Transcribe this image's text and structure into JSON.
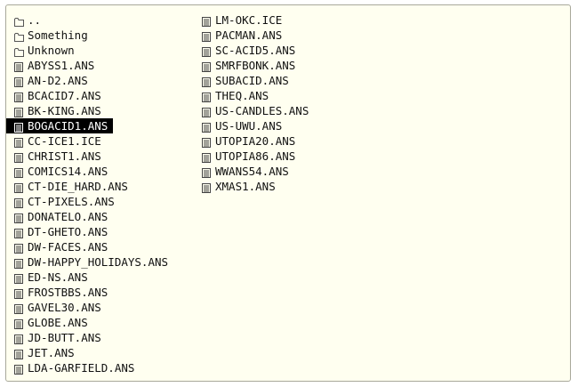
{
  "selected": "BOGACID1.ANS",
  "columns": [
    [
      {
        "name": "..",
        "type": "folder"
      },
      {
        "name": "Something",
        "type": "folder"
      },
      {
        "name": "Unknown",
        "type": "folder"
      },
      {
        "name": "ABYSS1.ANS",
        "type": "file"
      },
      {
        "name": "AN-D2.ANS",
        "type": "file"
      },
      {
        "name": "BCACID7.ANS",
        "type": "file"
      },
      {
        "name": "BK-KING.ANS",
        "type": "file"
      },
      {
        "name": "BOGACID1.ANS",
        "type": "file"
      },
      {
        "name": "CC-ICE1.ICE",
        "type": "file"
      },
      {
        "name": "CHRIST1.ANS",
        "type": "file"
      },
      {
        "name": "COMICS14.ANS",
        "type": "file"
      },
      {
        "name": "CT-DIE_HARD.ANS",
        "type": "file"
      },
      {
        "name": "CT-PIXELS.ANS",
        "type": "file"
      },
      {
        "name": "DONATELO.ANS",
        "type": "file"
      },
      {
        "name": "DT-GHETO.ANS",
        "type": "file"
      },
      {
        "name": "DW-FACES.ANS",
        "type": "file"
      },
      {
        "name": "DW-HAPPY_HOLIDAYS.ANS",
        "type": "file"
      },
      {
        "name": "ED-NS.ANS",
        "type": "file"
      },
      {
        "name": "FROSTBBS.ANS",
        "type": "file"
      },
      {
        "name": "GAVEL30.ANS",
        "type": "file"
      },
      {
        "name": "GLOBE.ANS",
        "type": "file"
      },
      {
        "name": "JD-BUTT.ANS",
        "type": "file"
      },
      {
        "name": "JET.ANS",
        "type": "file"
      },
      {
        "name": "LDA-GARFIELD.ANS",
        "type": "file"
      }
    ],
    [
      {
        "name": "LM-OKC.ICE",
        "type": "file"
      },
      {
        "name": "PACMAN.ANS",
        "type": "file"
      },
      {
        "name": "SC-ACID5.ANS",
        "type": "file"
      },
      {
        "name": "SMRFBONK.ANS",
        "type": "file"
      },
      {
        "name": "SUBACID.ANS",
        "type": "file"
      },
      {
        "name": "THEQ.ANS",
        "type": "file"
      },
      {
        "name": "US-CANDLES.ANS",
        "type": "file"
      },
      {
        "name": "US-UWU.ANS",
        "type": "file"
      },
      {
        "name": "UTOPIA20.ANS",
        "type": "file"
      },
      {
        "name": "UTOPIA86.ANS",
        "type": "file"
      },
      {
        "name": "WWANS54.ANS",
        "type": "file"
      },
      {
        "name": "XMAS1.ANS",
        "type": "file"
      }
    ]
  ],
  "icons": {
    "folder": "folder-icon",
    "file": "document-icon"
  },
  "colors": {
    "background": "#fffff0",
    "border": "#a8a89a",
    "selection": "#000000",
    "selection_text": "#ffffff",
    "text": "#111111"
  }
}
